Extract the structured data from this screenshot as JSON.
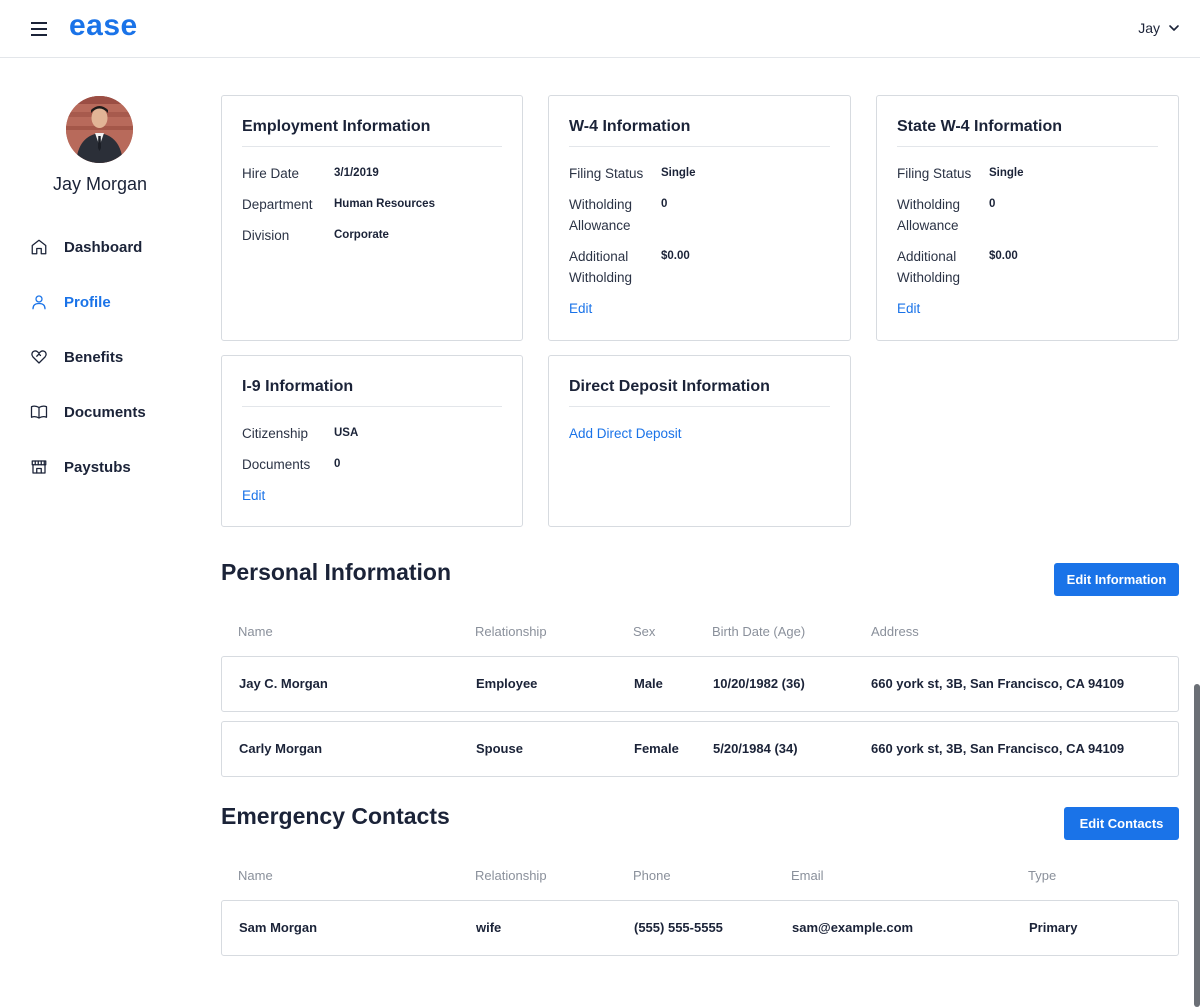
{
  "header": {
    "logo": "ease",
    "user_name": "Jay"
  },
  "sidebar": {
    "full_name": "Jay Morgan",
    "items": [
      {
        "label": "Dashboard",
        "icon": "home-icon"
      },
      {
        "label": "Profile",
        "icon": "user-icon",
        "active": true
      },
      {
        "label": "Benefits",
        "icon": "heart-icon"
      },
      {
        "label": "Documents",
        "icon": "book-icon"
      },
      {
        "label": "Paystubs",
        "icon": "store-icon"
      }
    ]
  },
  "employment": {
    "title": "Employment Information",
    "hire_date_label": "Hire Date",
    "hire_date": "3/1/2019",
    "department_label": "Department",
    "department": "Human Resources",
    "division_label": "Division",
    "division": "Corporate"
  },
  "w4": {
    "title": "W-4 Information",
    "filing_status_label": "Filing Status",
    "filing_status": "Single",
    "withholding_allowance_label": "Witholding Allowance",
    "withholding_allowance": "0",
    "additional_withholding_label": "Additional Witholding",
    "additional_withholding": "$0.00",
    "edit": "Edit"
  },
  "state_w4": {
    "title": "State W-4 Information",
    "filing_status_label": "Filing Status",
    "filing_status": "Single",
    "withholding_allowance_label": "Witholding Allowance",
    "withholding_allowance": "0",
    "additional_withholding_label": "Additional Witholding",
    "additional_withholding": "$0.00",
    "edit": "Edit"
  },
  "i9": {
    "title": "I-9 Information",
    "citizenship_label": "Citizenship",
    "citizenship": "USA",
    "documents_label": "Documents",
    "documents": "0",
    "edit": "Edit"
  },
  "direct_deposit": {
    "title": "Direct Deposit Information",
    "add": "Add Direct Deposit"
  },
  "personal": {
    "title": "Personal Information",
    "edit_button": "Edit Information",
    "columns": [
      "Name",
      "Relationship",
      "Sex",
      "Birth Date (Age)",
      "Address"
    ],
    "rows": [
      [
        "Jay C. Morgan",
        "Employee",
        "Male",
        "10/20/1982 (36)",
        "660 york st, 3B, San Francisco, CA 94109"
      ],
      [
        "Carly Morgan",
        "Spouse",
        "Female",
        "5/20/1984 (34)",
        "660 york st, 3B, San Francisco, CA 94109"
      ]
    ]
  },
  "emergency": {
    "title": "Emergency Contacts",
    "edit_button": "Edit Contacts",
    "columns": [
      "Name",
      "Relationship",
      "Phone",
      "Email",
      "Type"
    ],
    "rows": [
      [
        "Sam Morgan",
        "wife",
        "(555) 555-5555",
        "sam@example.com",
        "Primary"
      ]
    ]
  },
  "colors": {
    "accent": "#1a73e8",
    "text": "#1b2338",
    "muted": "#8a909b",
    "border": "#d7dbe0"
  }
}
